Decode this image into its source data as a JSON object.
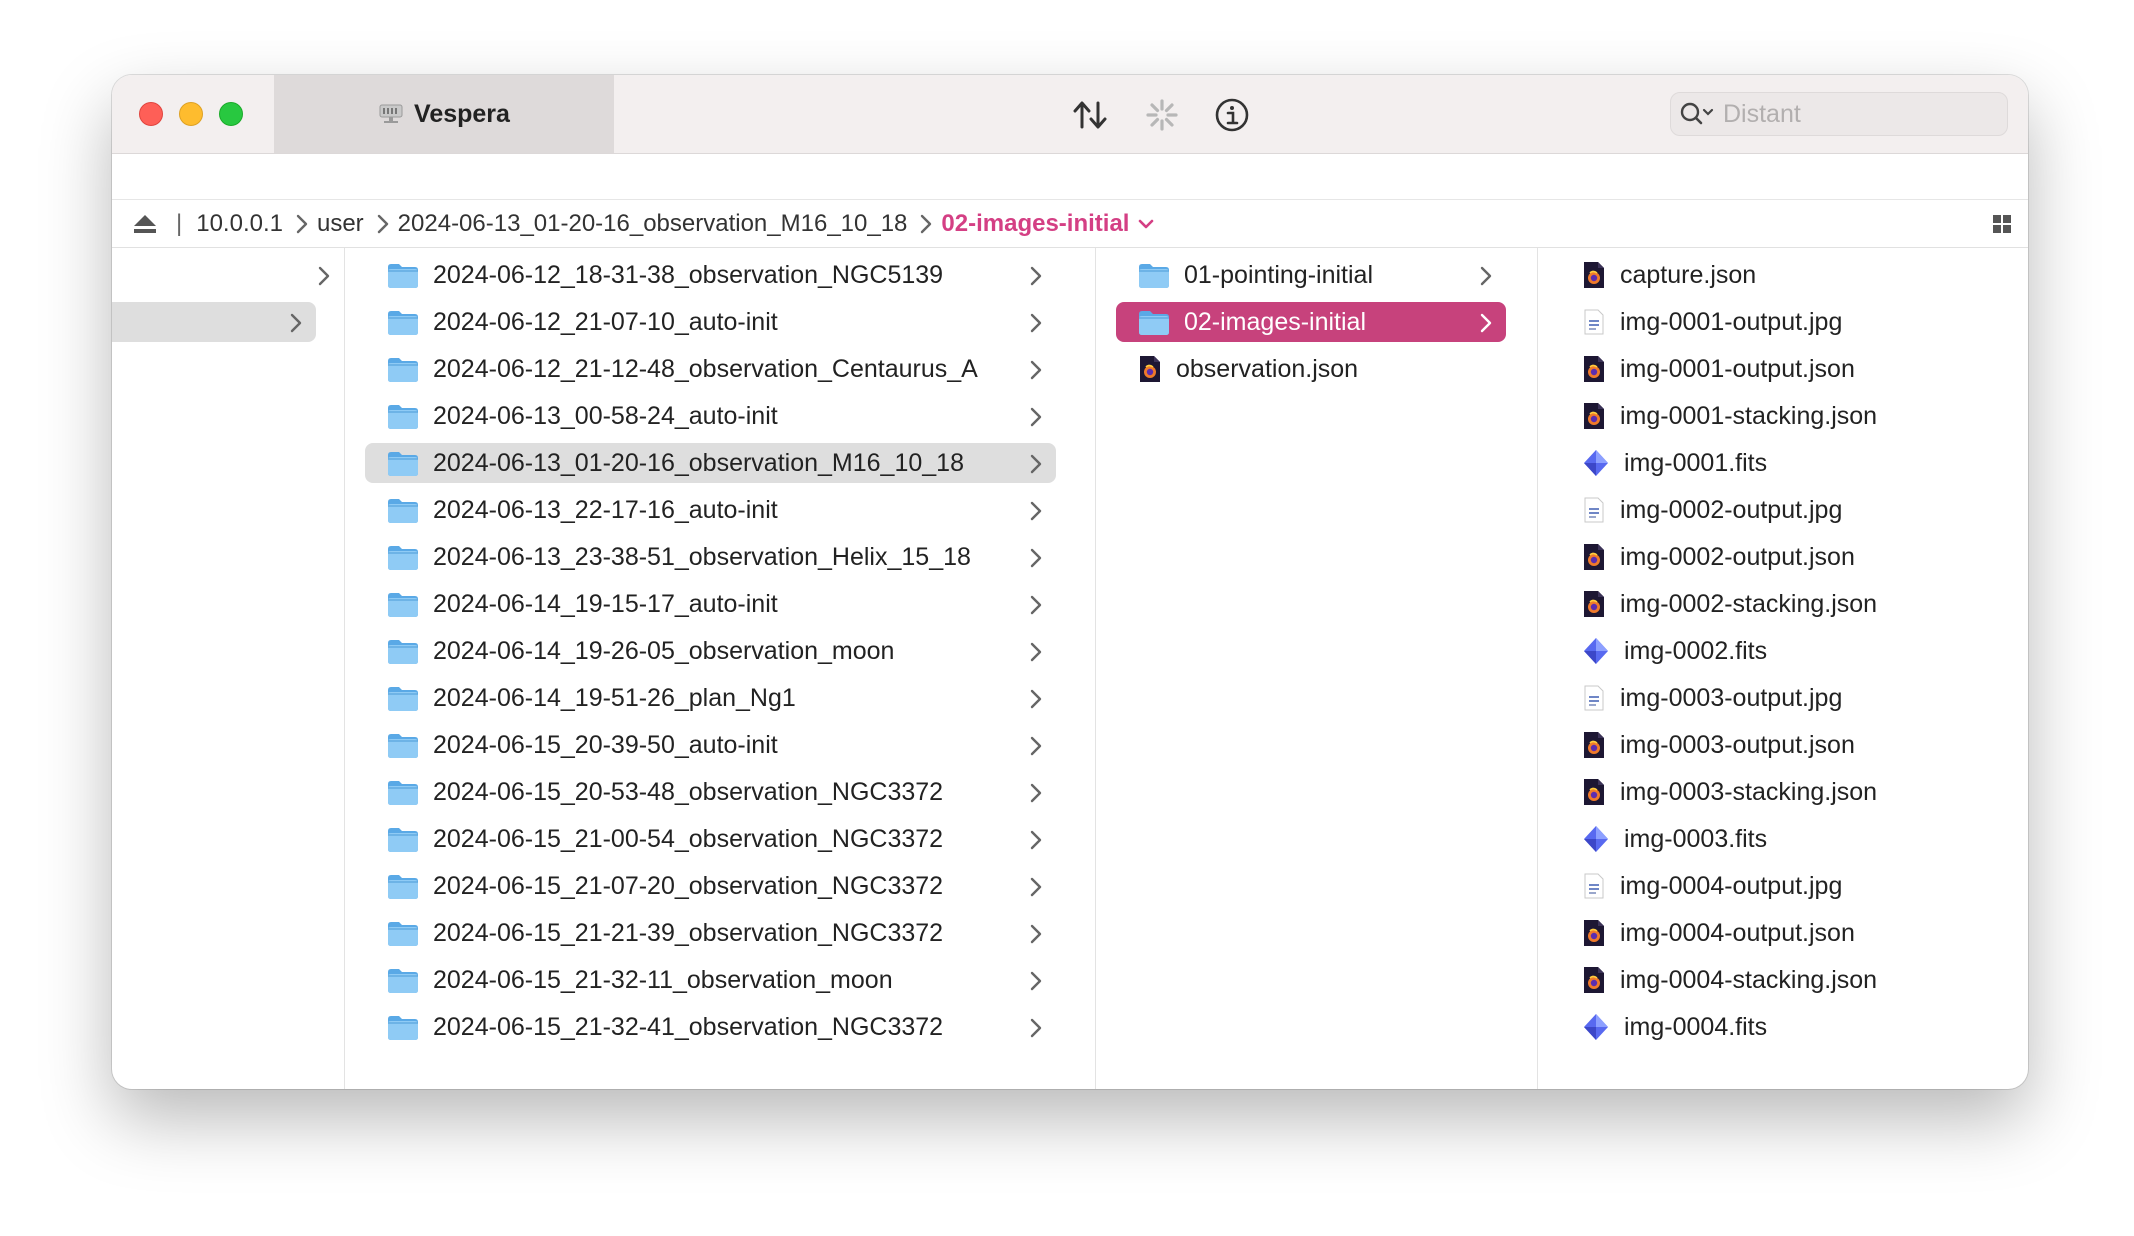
{
  "window": {
    "tab_title": "Vespera",
    "search_placeholder": "Distant"
  },
  "pathbar": {
    "crumbs": [
      "10.0.0.1",
      "user",
      "2024-06-13_01-20-16_observation_M16_10_18"
    ],
    "current": "02-images-initial"
  },
  "column2": {
    "items": [
      "2024-06-12_18-31-38_observation_NGC5139",
      "2024-06-12_21-07-10_auto-init",
      "2024-06-12_21-12-48_observation_Centaurus_A",
      "2024-06-13_00-58-24_auto-init",
      "2024-06-13_01-20-16_observation_M16_10_18",
      "2024-06-13_22-17-16_auto-init",
      "2024-06-13_23-38-51_observation_Helix_15_18",
      "2024-06-14_19-15-17_auto-init",
      "2024-06-14_19-26-05_observation_moon",
      "2024-06-14_19-51-26_plan_Ng1",
      "2024-06-15_20-39-50_auto-init",
      "2024-06-15_20-53-48_observation_NGC3372",
      "2024-06-15_21-00-54_observation_NGC3372",
      "2024-06-15_21-07-20_observation_NGC3372",
      "2024-06-15_21-21-39_observation_NGC3372",
      "2024-06-15_21-32-11_observation_moon",
      "2024-06-15_21-32-41_observation_NGC3372"
    ]
  },
  "column3": {
    "items": [
      "01-pointing-initial",
      "02-images-initial",
      "observation.json"
    ]
  },
  "column4": {
    "items": [
      "capture.json",
      "img-0001-output.jpg",
      "img-0001-output.json",
      "img-0001-stacking.json",
      "img-0001.fits",
      "img-0002-output.jpg",
      "img-0002-output.json",
      "img-0002-stacking.json",
      "img-0002.fits",
      "img-0003-output.jpg",
      "img-0003-output.json",
      "img-0003-stacking.json",
      "img-0003.fits",
      "img-0004-output.jpg",
      "img-0004-output.json",
      "img-0004-stacking.json",
      "img-0004.fits"
    ]
  },
  "colors": {
    "accent": "#c7427c",
    "crumb_current": "#d43f84",
    "folder_blue": "#6cb8ee"
  },
  "icons": {
    "folder": "folder-icon",
    "json": "json-file-icon",
    "jpg": "image-file-icon",
    "fits": "fits-file-icon"
  }
}
